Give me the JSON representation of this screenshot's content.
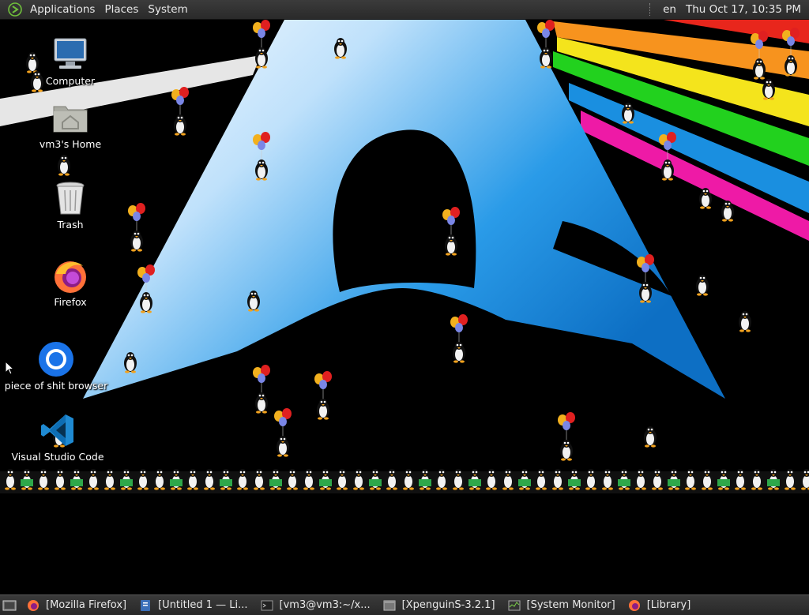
{
  "top_panel": {
    "menu": [
      "Applications",
      "Places",
      "System"
    ],
    "keyboard_layout": "en",
    "clock": "Thu Oct 17, 10:35 PM"
  },
  "desktop_icons": [
    {
      "label": "Computer",
      "icon": "computer-icon"
    },
    {
      "label": "vm3's Home",
      "icon": "home-folder-icon"
    },
    {
      "label": "Trash",
      "icon": "trash-icon"
    },
    {
      "label": "Firefox",
      "icon": "firefox-icon"
    },
    {
      "label": "piece of shit browser",
      "icon": "chromium-icon"
    },
    {
      "label": "Visual Studio Code",
      "icon": "vscode-icon"
    }
  ],
  "taskbar": [
    {
      "label": "[Mozilla Firefox]",
      "icon": "firefox-icon"
    },
    {
      "label": "[Untitled 1 — Li...",
      "icon": "libreoffice-icon"
    },
    {
      "label": "[vm3@vm3:~/x...",
      "icon": "terminal-icon"
    },
    {
      "label": "[XpenguinS-3.2.1]",
      "icon": "window-icon"
    },
    {
      "label": "[System Monitor]",
      "icon": "monitor-icon"
    },
    {
      "label": "[Library]",
      "icon": "firefox-icon"
    }
  ],
  "colors": {
    "panel": "#2f2f2f",
    "arch_blue": "#1793d1",
    "rainbow": [
      "#e8261c",
      "#f7931e",
      "#f4e41c",
      "#22d11e",
      "#1a8fe0",
      "#ee1aa6"
    ]
  }
}
